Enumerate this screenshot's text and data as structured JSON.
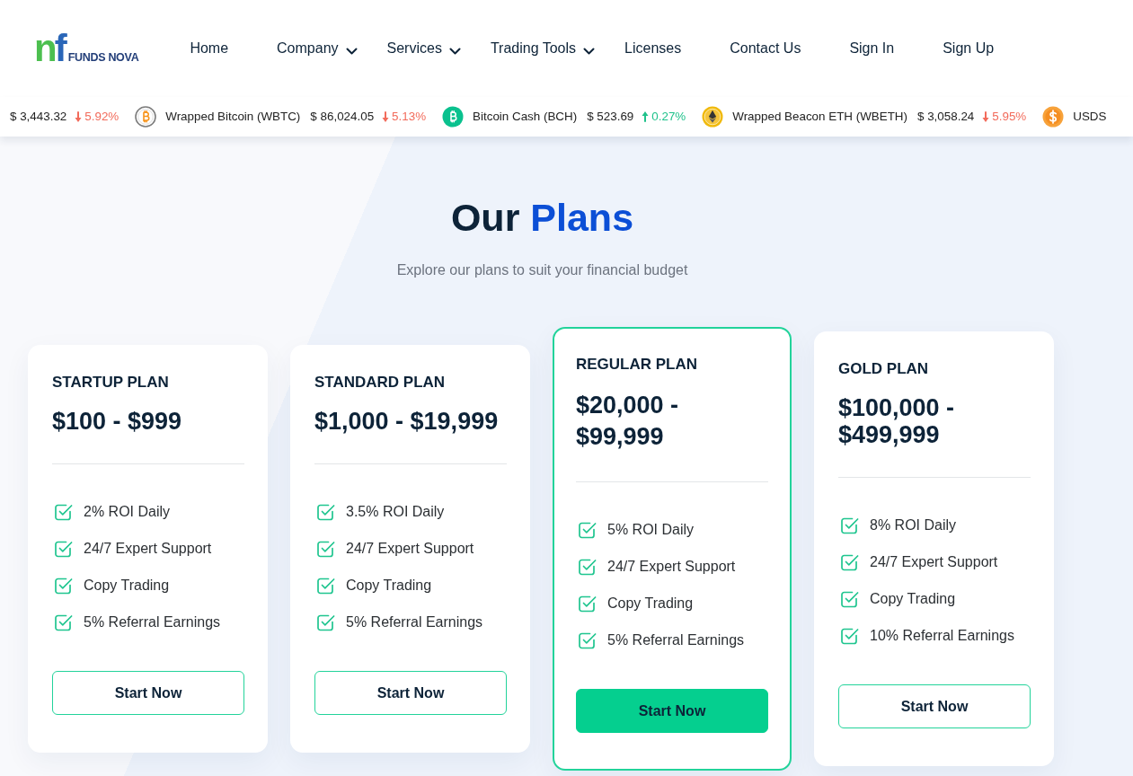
{
  "logo": {
    "mark": "nf",
    "text": "FUNDS NOVA"
  },
  "nav": [
    {
      "label": "Home",
      "dropdown": false
    },
    {
      "label": "Company",
      "dropdown": true
    },
    {
      "label": "Services",
      "dropdown": true
    },
    {
      "label": "Trading Tools",
      "dropdown": true
    },
    {
      "label": "Licenses",
      "dropdown": false
    },
    {
      "label": "Contact Us",
      "dropdown": false
    },
    {
      "label": "Sign In",
      "dropdown": false
    },
    {
      "label": "Sign Up",
      "dropdown": false
    }
  ],
  "ticker": [
    {
      "price": "$ 3,443.32",
      "change": "5.92%",
      "rising": false
    },
    {
      "kind": "btc-ring",
      "name": "Wrapped Bitcoin (WBTC)",
      "price": "$ 86,024.05",
      "change": "5.13%",
      "rising": false
    },
    {
      "kind": "btc",
      "name": "Bitcoin Cash (BCH)",
      "price": "$ 523.69",
      "change": "0.27%",
      "rising": true
    },
    {
      "kind": "eth",
      "name": "Wrapped Beacon ETH (WBETH)",
      "price": "$ 3,058.24",
      "change": "5.95%",
      "rising": false
    },
    {
      "kind": "dollar",
      "name": "USDS"
    }
  ],
  "section": {
    "title": "Our",
    "title_accent": "Plans",
    "subtitle": "Explore our plans to suit your financial budget"
  },
  "plans": [
    {
      "name": "STARTUP PLAN",
      "price": "$100 - $999",
      "features": [
        "2% ROI Daily",
        "24/7 Expert Support",
        "Copy Trading",
        "5% Referral Earnings"
      ],
      "button": "Start Now",
      "highlighted": false
    },
    {
      "name": "STANDARD PLAN",
      "price": "$1,000 - $19,999",
      "features": [
        "3.5% ROI Daily",
        "24/7 Expert Support",
        "Copy Trading",
        "5% Referral Earnings"
      ],
      "button": "Start Now",
      "highlighted": false
    },
    {
      "name": "REGULAR PLAN",
      "price": "$20,000 - $99,999",
      "features": [
        "5% ROI Daily",
        "24/7 Expert Support",
        "Copy Trading",
        "5% Referral Earnings"
      ],
      "button": "Start Now",
      "highlighted": true
    },
    {
      "name": "GOLD PLAN",
      "price": "$100,000 - $499,999",
      "features": [
        "8% ROI Daily",
        "24/7 Expert Support",
        "Copy Trading",
        "10% Referral Earnings"
      ],
      "button": "Start Now",
      "highlighted": false
    }
  ]
}
